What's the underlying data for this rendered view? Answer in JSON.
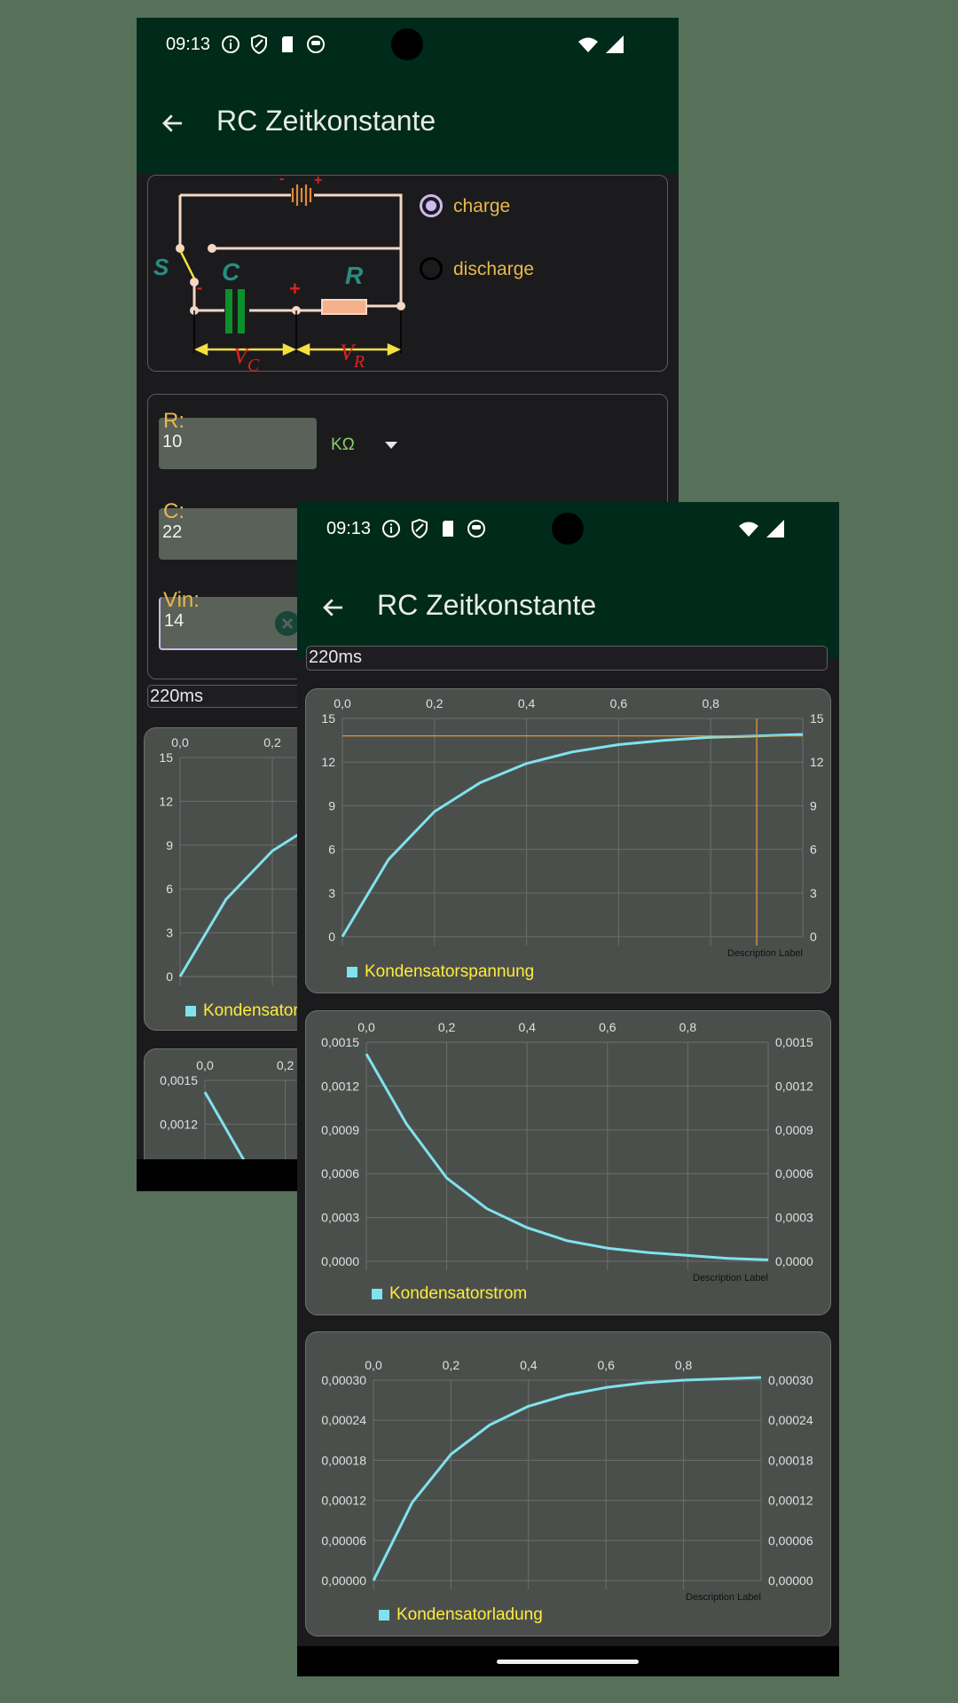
{
  "status": {
    "time": "09:13"
  },
  "app": {
    "title": "RC Zeitkonstante"
  },
  "circuit": {
    "polarity_minus": "-",
    "polarity_plus": "+",
    "switch_label": "S",
    "cap_label": "C",
    "res_label": "R",
    "cap_minus": "-",
    "cap_plus": "+",
    "vc_main": "V",
    "vc_sub": "C",
    "vr_main": "V",
    "vr_sub": "R"
  },
  "mode": {
    "options": [
      "charge",
      "discharge"
    ],
    "selected": "charge"
  },
  "inputs": {
    "r": {
      "label": "R:",
      "value": "10",
      "unit": "KΩ"
    },
    "c": {
      "label": "C:",
      "value": "22"
    },
    "vin": {
      "label": "Vin:",
      "value": "14"
    }
  },
  "time_constant": "220ms",
  "description_label": "Description Label",
  "colors": {
    "curve": "#7fe3ee",
    "marker": "#e8a040",
    "legend_text": "#ffeb3b",
    "label_orange": "#e8b84a"
  },
  "chart_data": [
    {
      "type": "line",
      "legend": "Kondensatorspannung",
      "x_ticks": [
        "0,0",
        "0,2",
        "0,4",
        "0,6",
        "0,8"
      ],
      "y_ticks": [
        "0",
        "3",
        "6",
        "9",
        "12",
        "15"
      ],
      "xlim": [
        0,
        1.0
      ],
      "ylim": [
        0,
        15
      ],
      "x": [
        0,
        0.1,
        0.2,
        0.3,
        0.4,
        0.5,
        0.6,
        0.7,
        0.8,
        0.9,
        1.0
      ],
      "y": [
        0,
        5.3,
        8.6,
        10.6,
        11.9,
        12.7,
        13.2,
        13.5,
        13.7,
        13.8,
        13.9
      ],
      "marker": {
        "x": 0.9,
        "y": 13.8
      }
    },
    {
      "type": "line",
      "legend": "Kondensatorstrom",
      "x_ticks": [
        "0,0",
        "0,2",
        "0,4",
        "0,6",
        "0,8"
      ],
      "y_ticks": [
        "0,0000",
        "0,0003",
        "0,0006",
        "0,0009",
        "0,0012",
        "0,0015"
      ],
      "xlim": [
        0,
        1.0
      ],
      "ylim": [
        0,
        0.0015
      ],
      "x": [
        0,
        0.1,
        0.2,
        0.3,
        0.4,
        0.5,
        0.6,
        0.7,
        0.8,
        0.9,
        1.0
      ],
      "y": [
        0.00142,
        0.00094,
        0.00057,
        0.00036,
        0.00023,
        0.00014,
        9e-05,
        6e-05,
        4e-05,
        2e-05,
        1e-05
      ]
    },
    {
      "type": "line",
      "legend": "Kondensatorladung",
      "x_ticks": [
        "0,0",
        "0,2",
        "0,4",
        "0,6",
        "0,8"
      ],
      "y_ticks": [
        "0,00000",
        "0,00006",
        "0,00012",
        "0,00018",
        "0,00024",
        "0,00030"
      ],
      "xlim": [
        0,
        1.0
      ],
      "ylim": [
        0,
        0.0003
      ],
      "x": [
        0,
        0.1,
        0.2,
        0.3,
        0.4,
        0.5,
        0.6,
        0.7,
        0.8,
        0.9,
        1.0
      ],
      "y": [
        0,
        0.000117,
        0.000189,
        0.000233,
        0.000261,
        0.000278,
        0.000289,
        0.000296,
        0.0003,
        0.000302,
        0.000304
      ]
    }
  ]
}
